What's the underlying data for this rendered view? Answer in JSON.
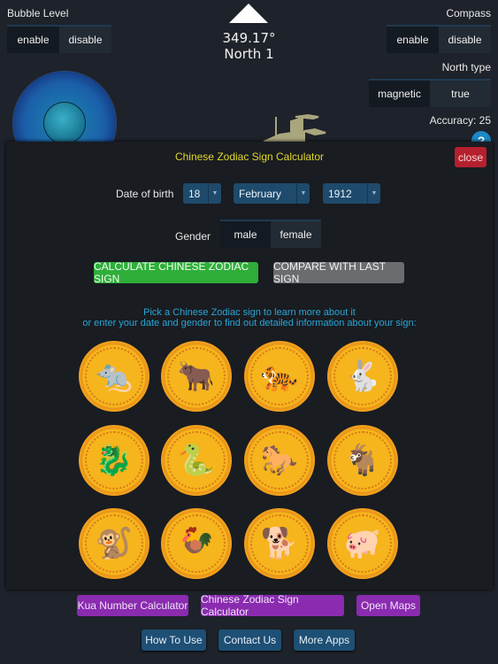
{
  "bubble_level": {
    "label": "Bubble Level",
    "enable": "enable",
    "disable": "disable",
    "selected": "enable"
  },
  "compass": {
    "label": "Compass",
    "enable": "enable",
    "disable": "disable",
    "selected": "enable",
    "heading": "349.17°",
    "direction": "North 1",
    "north_type_label": "North type",
    "magnetic": "magnetic",
    "true": "true",
    "north_selected": "magnetic",
    "accuracy": "Accuracy: 25"
  },
  "help_icon": "?",
  "modal": {
    "title": "Chinese Zodiac Sign Calculator",
    "close": "close",
    "dob_label": "Date of birth",
    "day": "18",
    "month": "February",
    "year": "1912",
    "caret": "▼",
    "gender_label": "Gender",
    "male": "male",
    "female": "female",
    "gender_selected": "male",
    "calculate": "CALCULATE CHINESE ZODIAC SIGN",
    "compare": "COMPARE WITH LAST SIGN",
    "info_line1": "Pick a Chinese Zodiac sign to learn more about it",
    "info_line2": "or enter your date and gender to find out detailed information about your sign:",
    "signs": [
      {
        "name": "rat",
        "glyph": "🐀"
      },
      {
        "name": "ox",
        "glyph": "🐂"
      },
      {
        "name": "tiger",
        "glyph": "🐅"
      },
      {
        "name": "rabbit",
        "glyph": "🐇"
      },
      {
        "name": "dragon",
        "glyph": "🐉"
      },
      {
        "name": "snake",
        "glyph": "🐍"
      },
      {
        "name": "horse",
        "glyph": "🐎"
      },
      {
        "name": "goat",
        "glyph": "🐐"
      },
      {
        "name": "monkey",
        "glyph": "🐒"
      },
      {
        "name": "rooster",
        "glyph": "🐓"
      },
      {
        "name": "dog",
        "glyph": "🐕"
      },
      {
        "name": "pig",
        "glyph": "🐖"
      }
    ]
  },
  "footer": {
    "row1": [
      "Kua Number Calculator",
      "Chinese Zodiac Sign Calculator",
      "Open Maps"
    ],
    "row2": [
      "How To Use",
      "Contact Us",
      "More Apps"
    ]
  }
}
